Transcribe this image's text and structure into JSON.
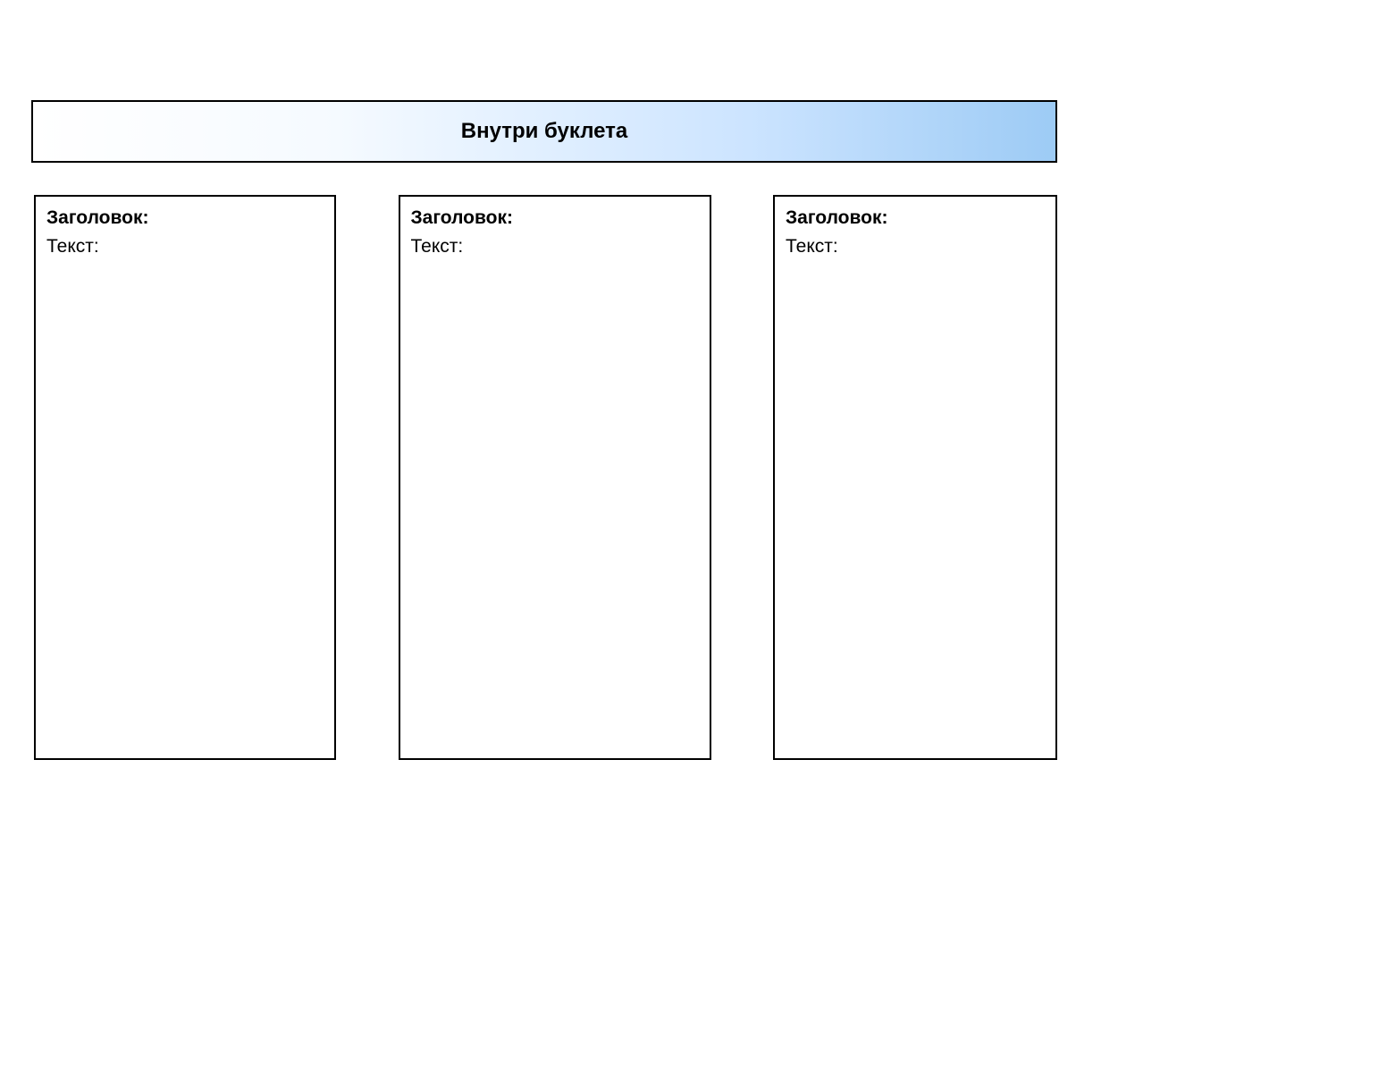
{
  "banner": {
    "title": "Внутри буклета"
  },
  "panels": [
    {
      "header_label": "Заголовок:",
      "text_label": "Текст:"
    },
    {
      "header_label": "Заголовок:",
      "text_label": "Текст:"
    },
    {
      "header_label": "Заголовок:",
      "text_label": "Текст:"
    }
  ]
}
